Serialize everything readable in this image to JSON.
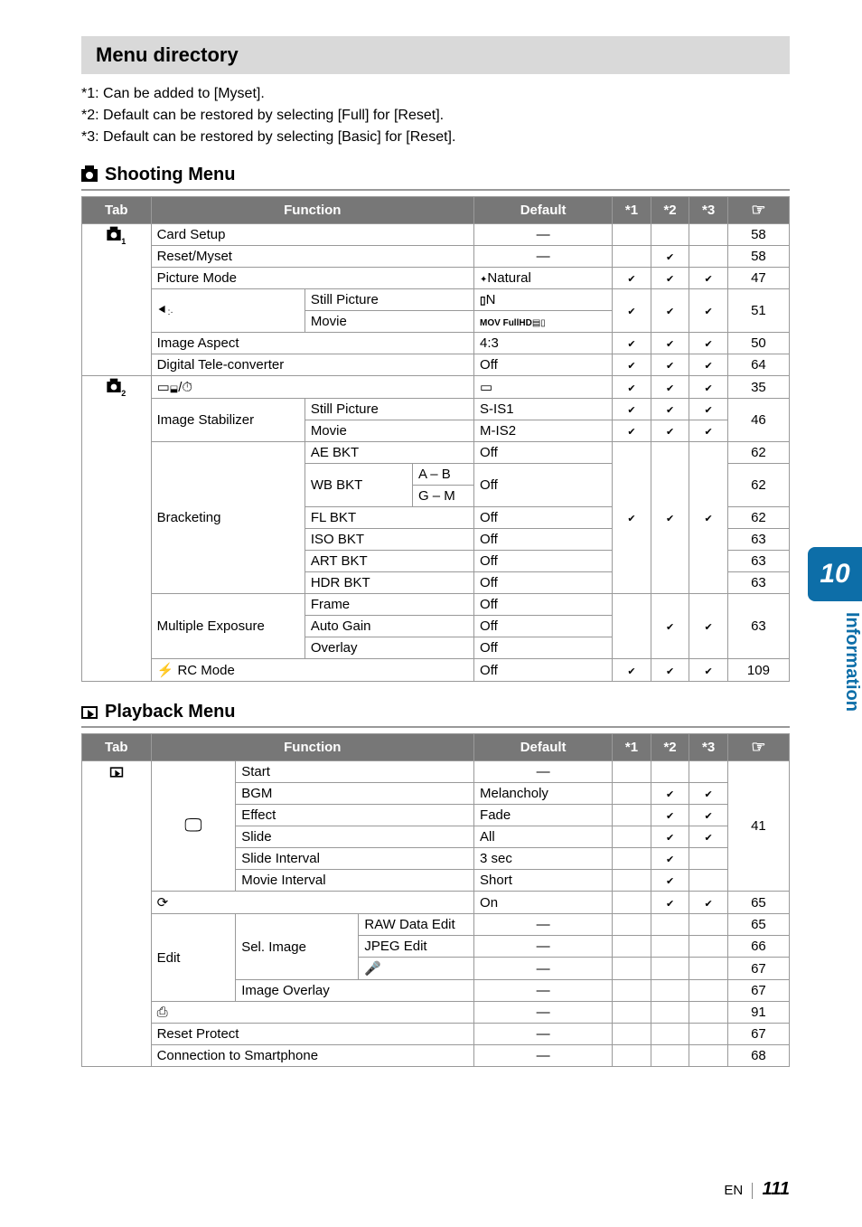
{
  "page": {
    "title": "Menu directory",
    "notes": [
      "*1: Can be added to [Myset].",
      "*2: Default can be restored by selecting [Full] for [Reset].",
      "*3: Default can be restored by selecting [Basic] for [Reset]."
    ]
  },
  "shooting": {
    "heading": "Shooting Menu",
    "headers": {
      "tab": "Tab",
      "function": "Function",
      "default": "Default",
      "s1": "*1",
      "s2": "*2",
      "s3": "*3"
    },
    "rows": {
      "card_setup_fn": "Card Setup",
      "card_setup_def": "―",
      "card_setup_pg": "58",
      "reset_fn": "Reset/Myset",
      "reset_def": "―",
      "reset_pg": "58",
      "picmode_fn": "Picture Mode",
      "picmode_def": "Natural",
      "picmode_pg": "47",
      "still_fn": "Still Picture",
      "still_def": "N",
      "still_pg": "51",
      "movie_fn": "Movie",
      "movie_def": "MOV FullHD",
      "aspect_fn": "Image Aspect",
      "aspect_def": "4:3",
      "aspect_pg": "50",
      "digitele_fn": "Digital Tele-converter",
      "digitele_def": "Off",
      "digitele_pg": "64",
      "drive_def": "",
      "drive_pg": "35",
      "is_fn": "Image Stabilizer",
      "is_still_fn": "Still Picture",
      "is_still_def": "S-IS1",
      "is_pg": "46",
      "is_mov_fn": "Movie",
      "is_mov_def": "M-IS2",
      "brk_fn": "Bracketing",
      "ae_fn": "AE BKT",
      "ae_def": "Off",
      "ae_pg": "62",
      "wb_fn": "WB BKT",
      "wb_ab": "A – B",
      "wb_gm": "G – M",
      "wb_def": "Off",
      "wb_pg": "62",
      "fl_fn": "FL BKT",
      "fl_def": "Off",
      "fl_pg": "62",
      "iso_fn": "ISO BKT",
      "iso_def": "Off",
      "iso_pg": "63",
      "art_fn": "ART BKT",
      "art_def": "Off",
      "art_pg": "63",
      "hdr_fn": "HDR BKT",
      "hdr_def": "Off",
      "hdr_pg": "63",
      "me_fn": "Multiple Exposure",
      "me_frame_fn": "Frame",
      "me_frame_def": "Off",
      "me_auto_fn": "Auto Gain",
      "me_auto_def": "Off",
      "me_ov_fn": "Overlay",
      "me_ov_def": "Off",
      "me_pg": "63",
      "rc_fn": " RC Mode",
      "rc_def": "Off",
      "rc_pg": "109"
    }
  },
  "playback": {
    "heading": "Playback Menu",
    "headers": {
      "tab": "Tab",
      "function": "Function",
      "default": "Default",
      "s1": "*1",
      "s2": "*2",
      "s3": "*3"
    },
    "rows": {
      "start_fn": "Start",
      "start_def": "―",
      "bgm_fn": "BGM",
      "bgm_def": "Melancholy",
      "eff_fn": "Effect",
      "eff_def": "Fade",
      "slides_pg": "41",
      "slide_fn": "Slide",
      "slide_def": "All",
      "si_fn": "Slide Interval",
      "si_def": "3 sec",
      "mi_fn": "Movie Interval",
      "mi_def": "Short",
      "rot_def": "On",
      "rot_pg": "65",
      "edit_fn": "Edit",
      "sel_fn": "Sel. Image",
      "raw_fn": "RAW Data Edit",
      "raw_def": "―",
      "raw_pg": "65",
      "jpg_fn": "JPEG Edit",
      "jpg_def": "―",
      "jpg_pg": "66",
      "mic_def": "―",
      "mic_pg": "67",
      "iov_fn": "Image Overlay",
      "iov_def": "―",
      "iov_pg": "67",
      "print_def": "―",
      "print_pg": "91",
      "rp_fn": "Reset Protect",
      "rp_def": "―",
      "rp_pg": "67",
      "sp_fn": "Connection to Smartphone",
      "sp_def": "―",
      "sp_pg": "68"
    }
  },
  "sidebar": {
    "chapter": "10",
    "label": "Information"
  },
  "footer": {
    "lang": "EN",
    "page": "111"
  }
}
